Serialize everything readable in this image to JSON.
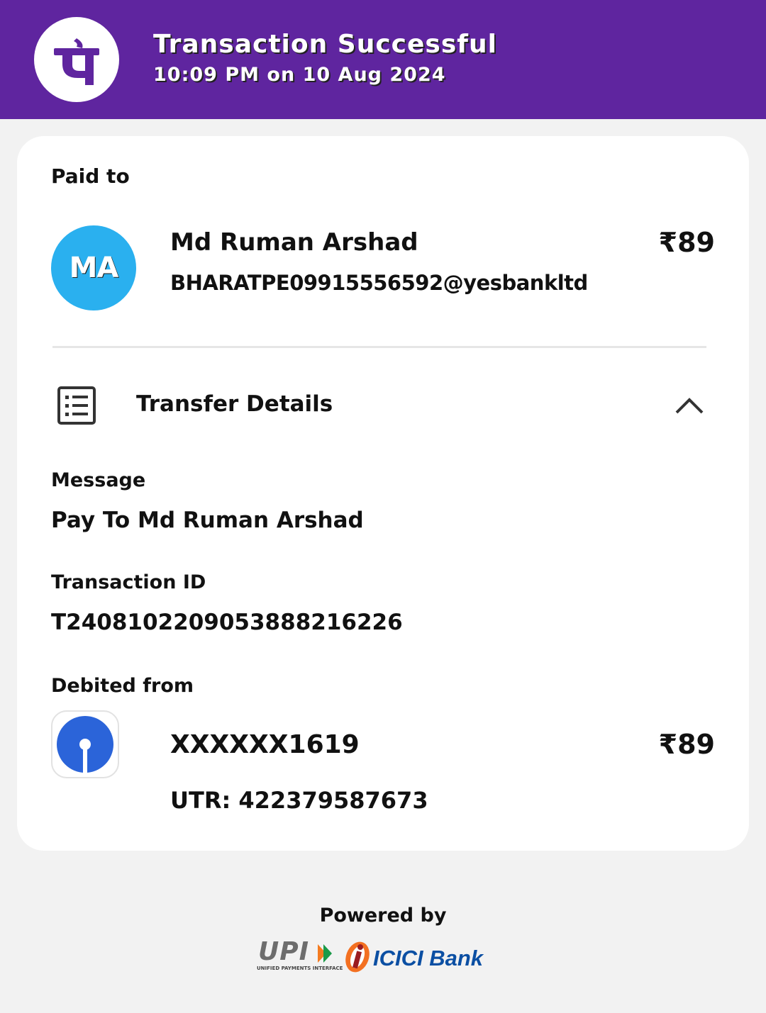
{
  "header": {
    "title": "Transaction Successful",
    "timestamp": "10:09 PM on 10 Aug 2024",
    "brand_color": "#5f259f",
    "logo_icon": "phonepe-logo"
  },
  "paid_to": {
    "label": "Paid to",
    "avatar_initials": "MA",
    "avatar_color": "#2ab0ef",
    "name": "Md Ruman Arshad",
    "upi_id": "BHARATPE09915556592@yesbankltd",
    "amount": "₹89"
  },
  "transfer_details": {
    "title": "Transfer Details",
    "icon": "receipt-list-icon",
    "toggle_icon": "chevron-up-icon",
    "message_label": "Message",
    "message_value": "Pay To Md Ruman Arshad",
    "transaction_id_label": "Transaction ID",
    "transaction_id_value": "T2408102209053888216226",
    "debited_from_label": "Debited from",
    "bank_icon": "sbi-bank-logo",
    "account_number": "XXXXXX1619",
    "debit_amount": "₹89",
    "utr": "UTR: 422379587673"
  },
  "footer": {
    "powered_by": "Powered by",
    "upi_logo_text": "UPI",
    "upi_logo_subtext": "UNIFIED PAYMENTS INTERFACE",
    "bank_name": "ICICI Bank"
  }
}
